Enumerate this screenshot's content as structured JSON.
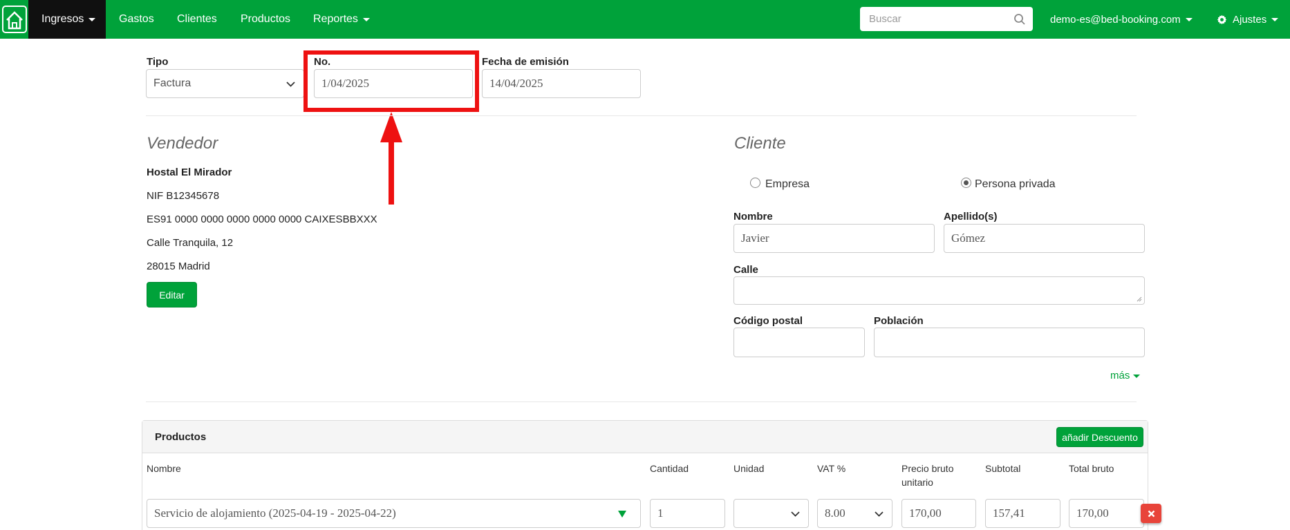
{
  "nav": {
    "income_label": "Ingresos",
    "expenses_label": "Gastos",
    "clients_label": "Clientes",
    "products_label": "Productos",
    "reports_label": "Reportes",
    "search_placeholder": "Buscar",
    "user_email": "demo-es@bed-booking.com",
    "settings_label": "Ajustes"
  },
  "form": {
    "type_label": "Tipo",
    "type_value": "Factura",
    "number_label": "No.",
    "number_value": "1/04/2025",
    "issue_date_label": "Fecha de emisión",
    "issue_date_value": "14/04/2025"
  },
  "seller": {
    "title": "Vendedor",
    "name": "Hostal El Mirador",
    "nif": "NIF B12345678",
    "iban": "ES91 0000 0000 0000 0000 0000 CAIXESBBXXX",
    "street": "Calle Tranquila, 12",
    "city": "28015 Madrid",
    "edit_label": "Editar"
  },
  "client": {
    "title": "Cliente",
    "company_label": "Empresa",
    "private_label": "Persona privada",
    "selected_type": "Persona privada",
    "first_name_label": "Nombre",
    "first_name_value": "Javier",
    "last_name_label": "Apellido(s)",
    "last_name_value": "Gómez",
    "street_label": "Calle",
    "street_value": "",
    "postal_label": "Código postal",
    "postal_value": "",
    "city_label": "Población",
    "city_value": "",
    "more_label": "más"
  },
  "products": {
    "title": "Productos",
    "add_discount_label": "añadir Descuento",
    "columns": {
      "name": "Nombre",
      "quantity": "Cantidad",
      "unit": "Unidad",
      "vat": "VAT %",
      "unit_price": "Precio bruto unitario",
      "subtotal": "Subtotal",
      "total": "Total bruto"
    },
    "rows": [
      {
        "name": "Servicio de alojamiento (2025-04-19 - 2025-04-22)",
        "quantity": "1",
        "unit": "",
        "vat": "8.00",
        "unit_price": "170,00",
        "subtotal": "157,41",
        "total": "170,00"
      }
    ]
  },
  "colors": {
    "brand_green": "#00a23a",
    "highlight_red": "#ee1111",
    "delete_red": "#e8443a"
  }
}
